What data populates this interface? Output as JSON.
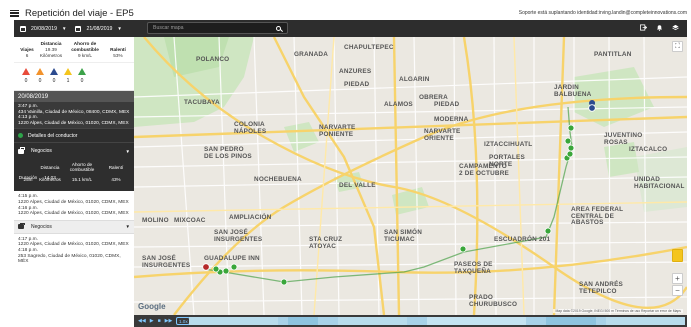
{
  "app": {
    "title": "Repetición del viaje - EP5",
    "impersonation": "Soporte está suplantando identidad:irving.landin@completeinnovations.com"
  },
  "toolbar": {
    "date_from": "20/08/2019",
    "date_to": "21/08/2019",
    "search_placeholder": "Buscar mapa",
    "icons": [
      "exit-icon",
      "bell-icon",
      "layers-icon"
    ]
  },
  "summary": {
    "viajes": {
      "label": "Viajes",
      "value": "6"
    },
    "distancia": {
      "label": "Distancia",
      "value": "19.39",
      "unit": "Kilómetros"
    },
    "ahorro": {
      "label": "Ahorro de combustible",
      "value": "9 km/L"
    },
    "ralenti": {
      "label": "Ralentí",
      "value": "53%"
    }
  },
  "alerts": [
    {
      "color": "#e84b3a",
      "count": "0"
    },
    {
      "color": "#f2922b",
      "count": "0"
    },
    {
      "color": "#2c4b8f",
      "count": "0"
    },
    {
      "color": "#f4c51d",
      "count": "1"
    },
    {
      "color": "#3ca24a",
      "count": "0"
    }
  ],
  "day_header": "20/08/2019",
  "trip1": {
    "start_time": "3:47 p.m.",
    "start_addr": "434 Vainilla, Ciudad de México, 08400, CDMX, MEX",
    "end_time": "4:13 p.m.",
    "end_addr": "1220 Alpes, Ciudad de México, 01020, CDMX, MEX"
  },
  "driver_details": "Detalles del conductor",
  "negocios1": "Negocios",
  "segment": {
    "h_distancia": "Distancia",
    "h_ahorro": "Ahorro de combustible",
    "h_ralenti": "Ralentí",
    "l_duracion": "Duración",
    "v_distancia": "14.03",
    "v_duracion": "25m",
    "v_km": "Kilómetros",
    "v_ahorro": "15.1 km/L",
    "v_ralenti": "43%"
  },
  "trip2": {
    "start_time": "4:15 p.m.",
    "start_addr": "1220 Alpes, Ciudad de México, 01020, CDMX, MEX",
    "end_time": "4:16 p.m.",
    "end_addr": "1220 Alpes, Ciudad de México, 01020, CDMX, MEX"
  },
  "negocios2": "Negocios",
  "trip3": {
    "start_time": "4:17 p.m.",
    "start_addr": "1220 Alpes, Ciudad de México, 01020, CDMX, MEX",
    "end_time": "4:18 p.m.",
    "end_addr": "253 Sagredo, Ciudad de México, 01020, CDMX, MÉX"
  },
  "map": {
    "labels": {
      "chapultepec": "CHAPULTEPEC",
      "polanco": "POLANCO",
      "granada": "GRANADA",
      "anzures": "ANZURES",
      "piedad": "PIEDAD",
      "algarin": "ALGARIN",
      "obrera": "OBRERA",
      "tacubaya": "TACUBAYA",
      "alamos": "ALAMOS",
      "piedad2": "PIEDAD",
      "moderna": "MODERNA",
      "jardin": "JARDIN\nBALBUENA",
      "colonia_napoles": "COLONIA\nNÁPOLES",
      "narvarte": "NARVARTE\nPONIENTE",
      "narvarte_or": "NARVARTE\nORIENTE",
      "portales": "PORTALES\nNORTE",
      "iztaccihuatl": "IZTACCIHUATL",
      "san_pedro": "SAN PEDRO\nDE LOS PINOS",
      "campamento": "CAMPAMENTO\n2 DE OCTUBRE",
      "nochebuena": "NOCHEBUENA",
      "del_valle": "DEL VALLE",
      "molino": "MOLINO",
      "mixcoac": "MIXCOAC",
      "ampl": "AMPLIACIÓN",
      "area_federal": "AREA FEDERAL\nCENTRAL DE\nABASTOS",
      "san_jose": "SAN JOSÉ\nINSURGENTES",
      "sta_cruz": "STA CRUZ\nATOYAC",
      "san_simon": "SAN SIMÓN\nTICUMAC",
      "escuadron": "ESCUADRÓN 201",
      "guadalupe": "GUADALUPE INN",
      "san_jose2": "SAN JOSÉ\nINSURGENTES",
      "paseos": "PASEOS DE\nTAXQUEÑA",
      "prado": "PRADO\nCHURUBUSCO",
      "pantitlan": "PANTITLAN",
      "juventino": "JUVENTINO\nROSAS",
      "iztacalco": "IZTACALCO",
      "unidad": "UNIDAD\nHABITACIONAL",
      "san_andres": "SAN ANDRÉS\nTETEPILCO"
    },
    "google": "Google",
    "attribution": "Map data ©2019 Google, INEGI   500 m   Términos de uso   Reportar un error de Maps"
  },
  "timeline": {
    "speed": "1.0x"
  }
}
